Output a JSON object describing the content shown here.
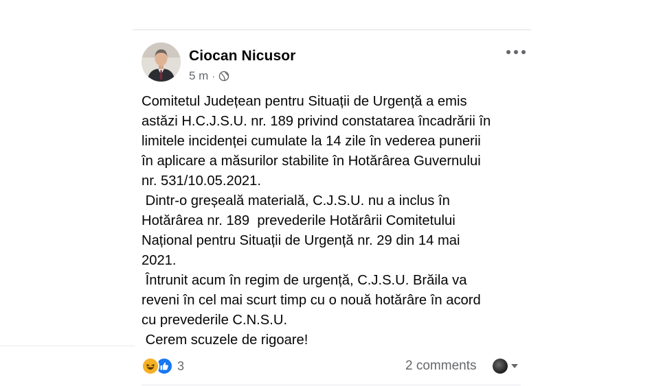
{
  "post": {
    "author": "Ciocan Nicusor",
    "time": "5 m",
    "separator": "·",
    "privacy_icon": "globe-icon",
    "menu_icon": "more-options-icon",
    "lines": [
      "Comitetul Județean pentru Situații de Urgență a emis",
      "astăzi H.C.J.S.U. nr. 189 privind constatarea încadrării în",
      "limitele incidenței cumulate la 14 zile în vederea punerii",
      "în aplicare a măsurilor stabilite în Hotărârea Guvernului",
      "nr. 531/10.05.2021.",
      " Dintr-o greșeală materială, C.J.S.U. nu a inclus în",
      "Hotărârea nr. 189  prevederile Hotărârii Comitetului",
      "Național pentru Situații de Urgență nr. 29 din 14 mai",
      "2021.",
      " Întrunit acum în regim de urgență, C.J.S.U. Brăila va",
      "reveni în cel mai scurt timp cu o nouă hotărâre în acord",
      "cu prevederile C.N.S.U.",
      " Cerem scuzele de rigoare!"
    ]
  },
  "footer": {
    "reaction_icons": [
      "haha-reaction-icon",
      "like-reaction-icon"
    ],
    "reaction_count": "3",
    "comments_label": "2 comments",
    "viewer_icon": "viewer-avatar-icon",
    "dropdown_icon": "chevron-down-icon"
  },
  "colors": {
    "text": "#050505",
    "secondary": "#65676b",
    "like_blue": "#1877f2",
    "haha_yellow": "#f7b125",
    "divider": "#dcdfe3"
  }
}
